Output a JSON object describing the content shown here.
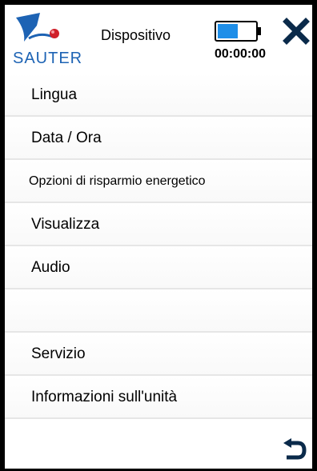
{
  "header": {
    "logo_text": "SAUTER",
    "title": "Dispositivo",
    "timer": "00:00:00",
    "battery_level": 0.55,
    "accent_color": "#1d63b4"
  },
  "menu": {
    "items": [
      {
        "label": "Lingua"
      },
      {
        "label": "Data / Ora"
      },
      {
        "label": "Opzioni di risparmio energetico"
      },
      {
        "label": "Visualizza"
      },
      {
        "label": "Audio"
      },
      {
        "label": ""
      },
      {
        "label": "Servizio"
      },
      {
        "label": "Informazioni sull'unità"
      }
    ]
  },
  "icons": {
    "close": "close-icon",
    "back": "back-arrow-icon",
    "battery": "battery-icon"
  }
}
